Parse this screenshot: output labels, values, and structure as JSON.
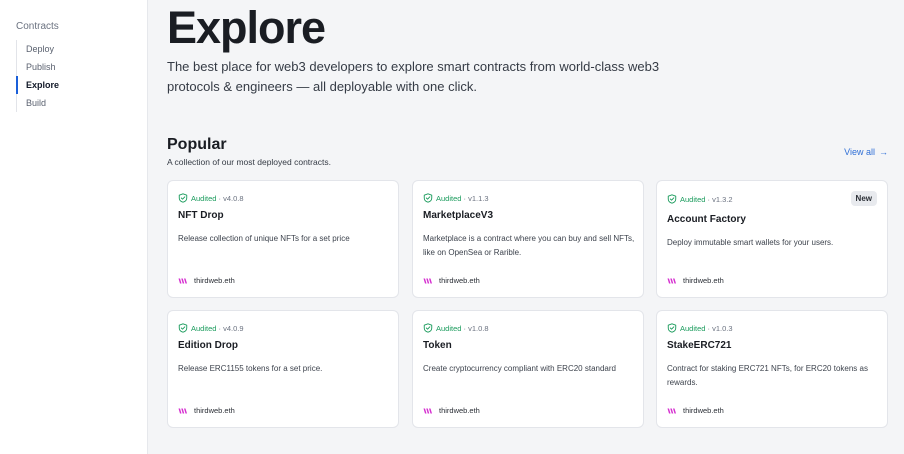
{
  "sidebar": {
    "heading": "Contracts",
    "items": [
      {
        "label": "Deploy"
      },
      {
        "label": "Publish"
      },
      {
        "label": "Explore"
      },
      {
        "label": "Build"
      }
    ]
  },
  "main": {
    "title": "Explore",
    "description": "The best place for web3 developers to explore smart contracts from world-class web3 protocols & engineers — all deployable with one click."
  },
  "popular": {
    "title": "Popular",
    "subtitle": "A collection of our most deployed contracts.",
    "view_all": "View all",
    "view_all_arrow": "→",
    "cards": [
      {
        "audited": "Audited",
        "version": "· v4.0.8",
        "name": "NFT Drop",
        "description": "Release collection of unique NFTs for a set price",
        "author": "thirdweb.eth",
        "badge": ""
      },
      {
        "audited": "Audited",
        "version": "· v1.1.3",
        "name": "MarketplaceV3",
        "description": "Marketplace is a contract where you can buy and sell NFTs, like on OpenSea or Rarible.",
        "author": "thirdweb.eth",
        "badge": ""
      },
      {
        "audited": "Audited",
        "version": "· v1.3.2",
        "name": "Account Factory",
        "description": "Deploy immutable smart wallets for your users.",
        "author": "thirdweb.eth",
        "badge": "New"
      },
      {
        "audited": "Audited",
        "version": "· v4.0.9",
        "name": "Edition Drop",
        "description": "Release ERC1155 tokens for a set price.",
        "author": "thirdweb.eth",
        "badge": ""
      },
      {
        "audited": "Audited",
        "version": "· v1.0.8",
        "name": "Token",
        "description": "Create cryptocurrency compliant with ERC20 standard",
        "author": "thirdweb.eth",
        "badge": ""
      },
      {
        "audited": "Audited",
        "version": "· v1.0.3",
        "name": "StakeERC721",
        "description": "Contract for staking ERC721 NFTs, for ERC20 tokens as rewards.",
        "author": "thirdweb.eth",
        "badge": ""
      }
    ]
  },
  "colors": {
    "accent": "#1a5fd9",
    "link": "#2f6fd6",
    "audited": "#1a9b5c",
    "author_logo": "#d62fd0"
  },
  "icons": {
    "audit": "shield-check-icon",
    "author": "thirdweb-logo-icon",
    "view_all": "arrow-right-icon"
  }
}
